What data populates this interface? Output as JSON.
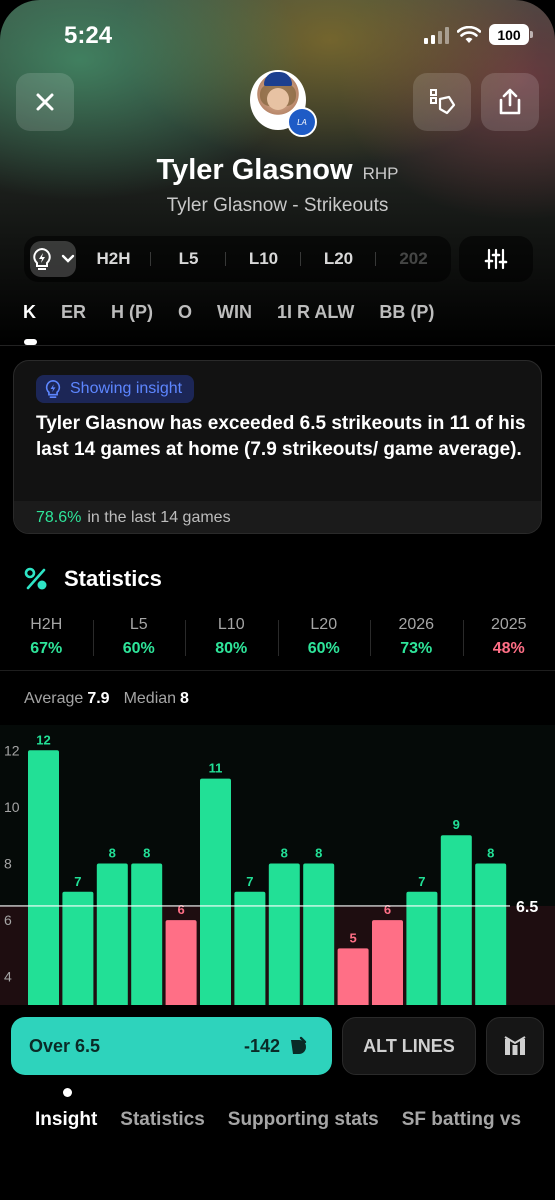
{
  "status_bar": {
    "time": "5:24",
    "battery": "100"
  },
  "header": {
    "player_name": "Tyler Glasnow",
    "position": "RHP",
    "subtitle": "Tyler Glasnow - Strikeouts",
    "team_badge": "Dodgers"
  },
  "filters": {
    "ranges": [
      "H2H",
      "L5",
      "L10",
      "L20",
      "202"
    ]
  },
  "stat_tabs": [
    "K",
    "ER",
    "H (P)",
    "O",
    "WIN",
    "1I R ALW",
    "BB (P)"
  ],
  "insight": {
    "badge": "Showing insight",
    "text": "Tyler Glasnow has exceeded 6.5 strikeouts in 11 of his last 14 games at home (7.9 strikeouts/ game average).",
    "foot_pct": "78.6%",
    "foot_text": "in the last 14 games"
  },
  "statistics": {
    "title": "Statistics",
    "columns": [
      {
        "label": "H2H",
        "value": "67%",
        "status": "green"
      },
      {
        "label": "L5",
        "value": "60%",
        "status": "green"
      },
      {
        "label": "L10",
        "value": "80%",
        "status": "green"
      },
      {
        "label": "L20",
        "value": "60%",
        "status": "green"
      },
      {
        "label": "2026",
        "value": "73%",
        "status": "green"
      },
      {
        "label": "2025",
        "value": "48%",
        "status": "red"
      }
    ],
    "average_label": "Average",
    "average_value": "7.9",
    "median_label": "Median",
    "median_value": "8"
  },
  "chart_data": {
    "type": "bar",
    "values": [
      12,
      7,
      8,
      8,
      6,
      11,
      7,
      8,
      8,
      5,
      6,
      7,
      9,
      8
    ],
    "line": 6.5,
    "line_label": "6.5",
    "y_ticks": [
      12,
      10,
      8,
      6,
      4
    ],
    "colors": {
      "over": "#22e096",
      "under": "#ff6f86"
    }
  },
  "bet": {
    "over_label": "Over 6.5",
    "odds": "-142",
    "alt_lines_label": "ALT LINES"
  },
  "bottom_tabs": [
    "Insight",
    "Statistics",
    "Supporting stats",
    "SF batting vs"
  ]
}
